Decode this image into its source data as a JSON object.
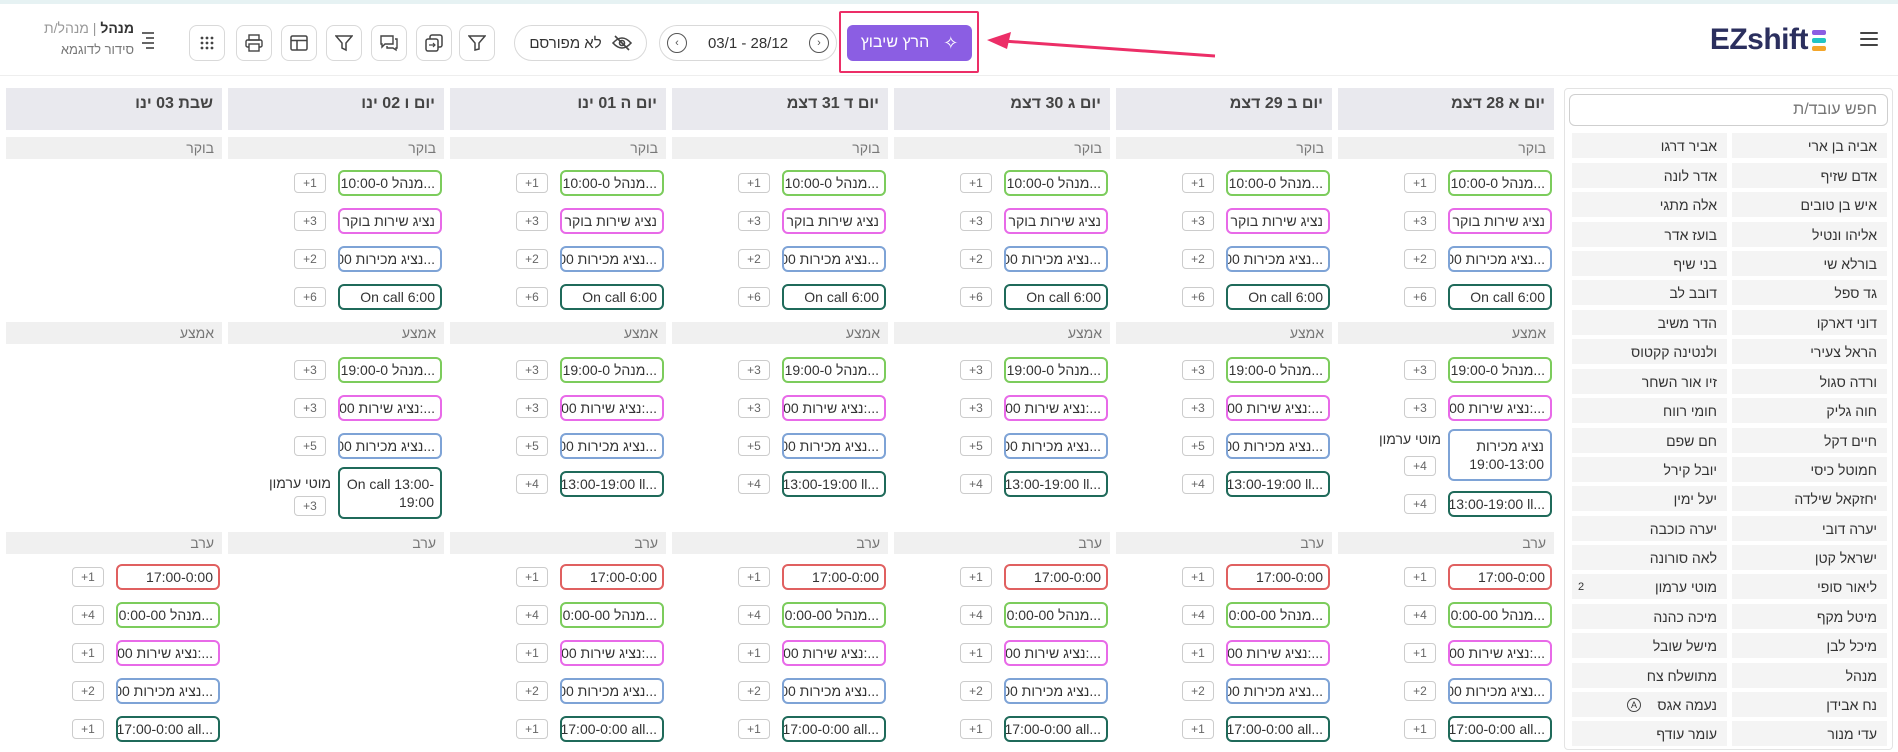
{
  "header": {
    "logo": "EZshift",
    "run_button": "הרץ שיבוץ",
    "date_range": "03/1 - 28/12",
    "unpublished": "לא מפורסם",
    "user_role": "מנהל",
    "user_title": "מנהל/ת",
    "user_schedule": "סידור לדוגמא",
    "colors": {
      "accent": "#8b5ee3",
      "highlight": "#ec2e67",
      "logo_navy": "#2b2f5e"
    }
  },
  "toolbar": {
    "icons": [
      "filter-icon",
      "copy-swap-icon",
      "chat-icon",
      "funnel-icon",
      "layout-icon",
      "print-icon",
      "apps-grid-icon"
    ]
  },
  "sidebar": {
    "search_placeholder": "חפש עובד/ת",
    "employees_right": [
      "אביה בן ארי",
      "אדם שזיף",
      "איש בן טובים",
      "אליהו ונטיל",
      "בורלא שי",
      "גד ספל",
      "דוני דארקו",
      "הראל צעירי",
      "ורדה סגול",
      "חוה גליק",
      "חיים דקל",
      "חמוטל כיסי",
      "יחזקאל שילדה",
      "יערה דובי",
      "ישראל קטן",
      "ליאור סופי",
      "מיטל מקף",
      "מיכל לבן",
      "מנהל",
      "נח אבידן",
      "עדי מנור"
    ],
    "employees_left": [
      "אביר דרגו",
      "אדר לונה",
      "אלה מתגי",
      "בועז אדר",
      "בני שיף",
      "דובב לב",
      "הדר משיב",
      "ולנטינה קקטוס",
      "זיו אור השחר",
      "חומי רווח",
      "חם שפם",
      "יובל קירל",
      "יעל ימין",
      "יערה כוכבה",
      "לאה סורונה",
      "מוטי ערמון",
      "מיכה כהנה",
      "מישל שובל",
      "מתושלח צח",
      "נעמה אגס",
      "עומר עודף"
    ],
    "moti_count": "2",
    "naama_badge": "A"
  },
  "days": [
    "יום א 28 דצמ",
    "יום ב 29 דצמ",
    "יום ג 30 דצמ",
    "יום ד 31 דצמ",
    "יום ה 01 ינו",
    "יום ו 02 ינו",
    "שבת 03 ינו"
  ],
  "sections": {
    "morning": "בוקר",
    "middle": "אמצע",
    "evening": "ערב"
  },
  "shifts": {
    "m1": "מנהל 10:00-0...",
    "m2": "נציג שירות בוקר",
    "m3": "נציג מכירות 00...",
    "m4": "On call 6:00",
    "a1": "מנהל 19:00-0...",
    "a2": "נציג שירות 00:...",
    "a3": "נציג מכירות 00...",
    "a4": "13:00-19:00 ll...",
    "a_sun3": "נציג מכירות 19:00-13:00",
    "a_fri4": "On call 13:00-19:00",
    "e1": "17:00-0:00",
    "e2": "מנהל 0:00-00...",
    "e3": "נציג שירות 00:...",
    "e4": "נציג מכירות 00...",
    "e5": "17:00-0:00 all..."
  },
  "counts": {
    "m": [
      "+1",
      "+3",
      "+2",
      "+6"
    ],
    "a": [
      "+3",
      "+3",
      "+5",
      "+4"
    ],
    "a_sun": [
      "+3",
      "+3",
      "+4",
      "+4"
    ],
    "a_fri": [
      "+3",
      "+3",
      "+5",
      "+3"
    ],
    "e": [
      "+1",
      "+4",
      "+1",
      "+2",
      "+1"
    ]
  },
  "assigned_name": "מוטי ערמון"
}
